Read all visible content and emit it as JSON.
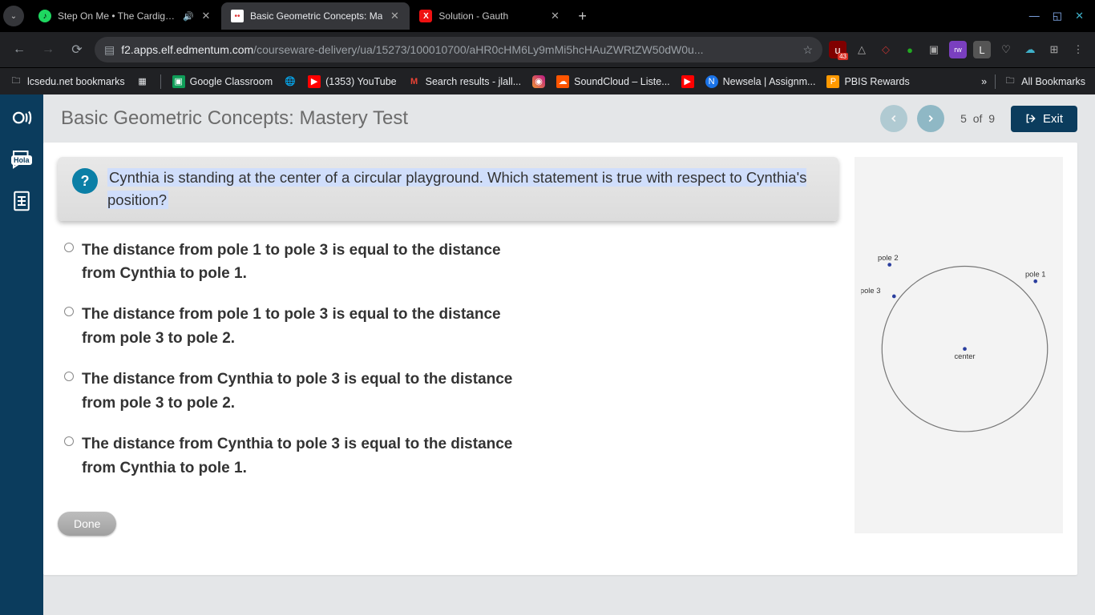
{
  "browser": {
    "tabs": [
      {
        "favicon": "spotify",
        "title": "Step On Me • The Cardigans",
        "audio": true
      },
      {
        "favicon": "edm",
        "title": "Basic Geometric Concepts: Ma",
        "active": true
      },
      {
        "favicon": "gauth",
        "title": "Solution - Gauth"
      }
    ],
    "url_domain": "f2.apps.elf.edmentum.com",
    "url_path": "/courseware-delivery/ua/15273/100010700/aHR0cHM6Ly9mMi5hcHAuZWRtZW50dW0u...",
    "ext_badge": "43",
    "bookmarks": [
      {
        "icon": "folder",
        "label": "lcsedu.net bookmarks"
      },
      {
        "icon": "grid",
        "label": ""
      },
      {
        "icon": "gc",
        "label": "Google Classroom"
      },
      {
        "icon": "globe",
        "label": ""
      },
      {
        "icon": "yt",
        "label": "(1353) YouTube"
      },
      {
        "icon": "gm",
        "label": "Search results - jlall..."
      },
      {
        "icon": "ig",
        "label": ""
      },
      {
        "icon": "sc",
        "label": "SoundCloud – Liste..."
      },
      {
        "icon": "yt",
        "label": ""
      },
      {
        "icon": "ns",
        "label": "Newsela | Assignm..."
      },
      {
        "icon": "pb",
        "label": "PBIS Rewards"
      }
    ],
    "bookmarks_overflow": "»",
    "all_bookmarks": "All Bookmarks"
  },
  "app": {
    "title": "Basic Geometric Concepts: Mastery Test",
    "progress_current": "5",
    "progress_of": "of",
    "progress_total": "9",
    "exit": "Exit"
  },
  "question": {
    "prompt": "Cynthia is standing at the center of a circular playground. Which statement is true with respect to Cynthia's position?",
    "options": [
      "The distance from pole 1 to pole 3 is equal to the distance from Cynthia to pole 1.",
      "The distance from pole 1 to pole 3 is equal to the distance from pole 3 to pole 2.",
      "The distance from Cynthia to pole 3 is equal to the distance from pole 3 to pole 2.",
      "The distance from Cynthia to pole 3 is equal to the distance from Cynthia to pole 1."
    ],
    "done": "Done"
  },
  "figure": {
    "labels": {
      "p1": "pole 1",
      "p2": "pole 2",
      "p3": "pole 3",
      "center": "center"
    }
  }
}
